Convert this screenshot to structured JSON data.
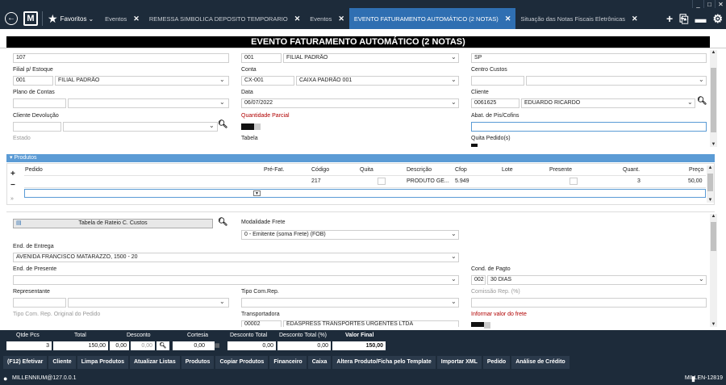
{
  "window": {
    "min": "_",
    "max": "□",
    "close": "✕"
  },
  "nav": {
    "favoritos": "Favoritos",
    "tabs": [
      {
        "label": "Eventos",
        "closable": true,
        "active": false
      },
      {
        "label": "REMESSA SIMBOLICA DEPOSITO TEMPORARIO",
        "closable": true,
        "active": false
      },
      {
        "label": "Eventos",
        "closable": true,
        "active": false
      },
      {
        "label": "EVENTO FATURAMENTO AUTOMÁTICO (2 NOTAS)",
        "closable": true,
        "active": true
      },
      {
        "label": "Situação das Notas Fiscais Eletrônicas",
        "closable": true,
        "active": false
      }
    ],
    "close_glyph": "✕"
  },
  "header": {
    "title": "EVENTO FATURAMENTO AUTOMÁTICO (2 NOTAS)"
  },
  "form": {
    "top_left_value": "107",
    "filial_label": "Filial p/ Estoque",
    "filial_code": "001",
    "filial_name": "FILIAL PADRÃO",
    "plano_label": "Plano de Contas",
    "cliente_dev_label": "Cliente Devolução",
    "estado_label": "Estado",
    "top_mid_code": "001",
    "top_mid_name": "FILIAL PADRÃO",
    "conta_label": "Conta",
    "conta_code": "CX-001",
    "conta_name": "CAIXA PADRÃO 001",
    "data_label": "Data",
    "data_value": "06/07/2022",
    "qtd_parcial_label": "Quantidade Parcial",
    "tabela_label": "Tabela",
    "top_right_value": "SP",
    "centro_label": "Centro Custos",
    "cliente_label": "Cliente",
    "cliente_code": "0061625",
    "cliente_name": "EDUARDO RICARDO",
    "abat_label": "Abat. de Pis/Cofins",
    "quita_label": "Quita Pedido(s)"
  },
  "produtos": {
    "title": "Produtos",
    "columns": [
      "Pedido",
      "Pré-Fat.",
      "Código",
      "Quita",
      "Descrição",
      "Cfop",
      "Lote",
      "Presente",
      "Quant.",
      "Preço"
    ],
    "row": {
      "codigo": "217",
      "descricao": "PRODUTO GE...",
      "cfop": "5.949",
      "quant": "3",
      "preco": "50,00"
    },
    "add": "+",
    "remove": "−",
    "expand": "»"
  },
  "lower": {
    "rateio_label": "Tabela de Rateio C. Custos",
    "modalidade_label": "Modalidade Frete",
    "modalidade_value": "0 - Emitente (soma Frete) (FOB)",
    "end_entrega_label": "End. de Entrega",
    "end_entrega_value": "AVENIDA FRANCISCO MATARAZZO, 1500 - 20",
    "end_presente_label": "End. de Presente",
    "cond_pagto_label": "Cond. de Pagto",
    "cond_pagto_code": "002",
    "cond_pagto_name": "30 DIAS",
    "representante_label": "Representante",
    "tipo_com_label": "Tipo Com.Rep.",
    "comissao_label": "Comissão Rep. (%)",
    "tipo_com_orig_label": "Tipo Com. Rep. Original do Pedido",
    "transportadora_label": "Transportadora",
    "transportadora_code": "00002",
    "transportadora_name": "EDASPRESS TRANSPORTES URGENTES LTDA",
    "frete_label": "Informar valor do frete"
  },
  "totals": {
    "qtde_label": "Qtde Pcs",
    "qtde": "3",
    "total_label": "Total",
    "total": "150,00",
    "desconto_label": "Desconto",
    "desconto_a": "0,00",
    "desconto_b": "0,00",
    "cortesia_label": "Cortesia",
    "cortesia": "0,00",
    "desc_total_label": "Desconto Total",
    "desc_total": "0,00",
    "desc_total_pct_label": "Desconto Total (%)",
    "desc_total_pct": "0,00",
    "valor_final_label": "Valor Final",
    "valor_final": "150,00"
  },
  "buttons": [
    "(F12) Efetivar",
    "Cliente",
    "Limpa Produtos",
    "Atualizar Listas",
    "Produtos",
    "Copiar Produtos",
    "Financeiro",
    "Caixa",
    "Altera Produto/Ficha pelo Template",
    "Importar XML",
    "Pedido",
    "Análise de Crédito"
  ],
  "status": {
    "user": "MILLENNIUM@127.0.0.1",
    "server": "MILLEN-12819"
  },
  "colors": {
    "nav_bg": "#1d2b3a",
    "active_tab": "#2f6fb2",
    "section_blue": "#5b9bd5",
    "required_red": "#b00000"
  }
}
